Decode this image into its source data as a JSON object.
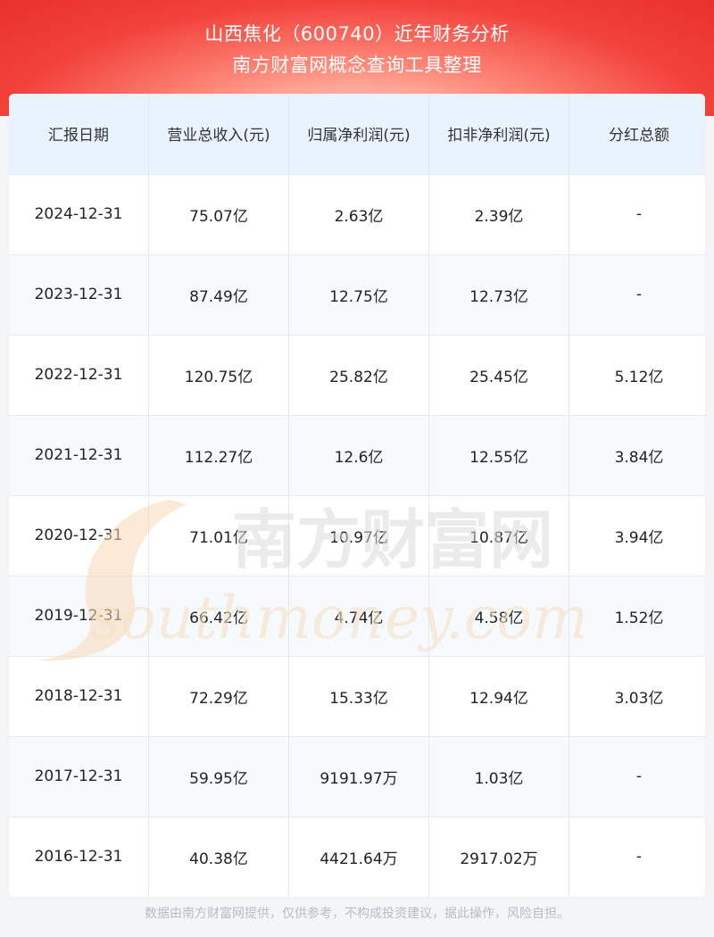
{
  "header": {
    "title": "山西焦化（600740）近年财务分析",
    "subtitle": "南方财富网概念查询工具整理"
  },
  "table": {
    "columns": [
      "汇报日期",
      "营业总收入(元)",
      "归属净利润(元)",
      "扣非净利润(元)",
      "分红总额"
    ],
    "rows": [
      [
        "2024-12-31",
        "75.07亿",
        "2.63亿",
        "2.39亿",
        "-"
      ],
      [
        "2023-12-31",
        "87.49亿",
        "12.75亿",
        "12.73亿",
        "-"
      ],
      [
        "2022-12-31",
        "120.75亿",
        "25.82亿",
        "25.45亿",
        "5.12亿"
      ],
      [
        "2021-12-31",
        "112.27亿",
        "12.6亿",
        "12.55亿",
        "3.84亿"
      ],
      [
        "2020-12-31",
        "71.01亿",
        "10.97亿",
        "10.87亿",
        "3.94亿"
      ],
      [
        "2019-12-31",
        "66.42亿",
        "4.74亿",
        "4.58亿",
        "1.52亿"
      ],
      [
        "2018-12-31",
        "72.29亿",
        "15.33亿",
        "12.94亿",
        "3.03亿"
      ],
      [
        "2017-12-31",
        "59.95亿",
        "9191.97万",
        "1.03亿",
        "-"
      ],
      [
        "2016-12-31",
        "40.38亿",
        "4421.64万",
        "2917.02万",
        "-"
      ]
    ]
  },
  "watermark": {
    "cn": "南方财富网",
    "en": "southmoney.com"
  },
  "footer": {
    "disclaimer": "数据由南方财富网提供，仅供参考，不构成投资建议，据此操作，风险自担。"
  },
  "colors": {
    "header_red": "#e8302c",
    "table_header_bg": "#e8f3fe",
    "footer_text": "#b8bcc3"
  }
}
